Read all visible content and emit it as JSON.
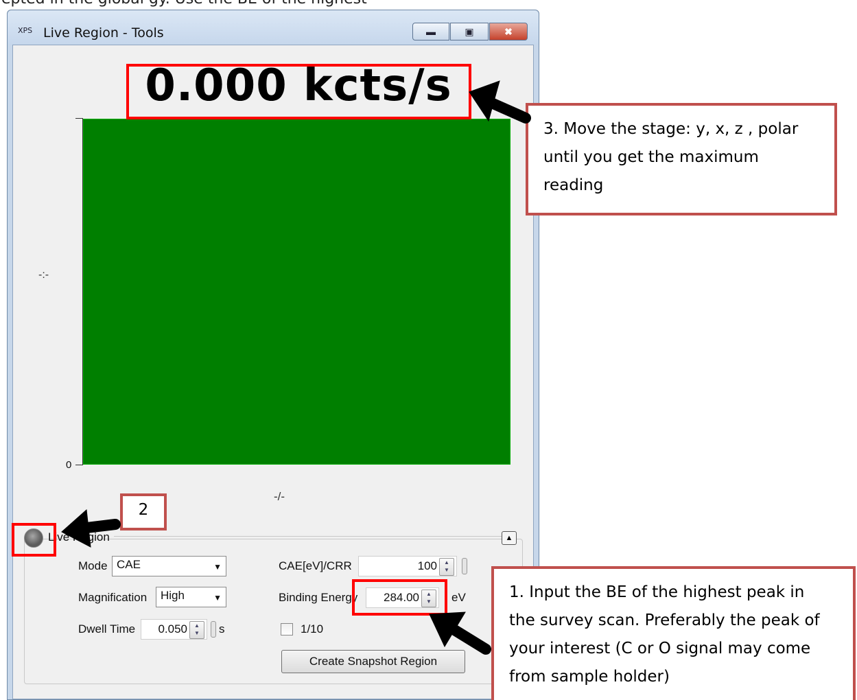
{
  "doc_text": "epted in the global gy. Use the BE of the highest",
  "window": {
    "app_icon": "XPS",
    "title": "Live Region - Tools",
    "buttons": {
      "minimize": "minimize-icon",
      "maximize": "maximize-icon",
      "close": "close-icon"
    }
  },
  "readout": {
    "value": "0.000 kcts/s"
  },
  "plot": {
    "y_zero": "0",
    "y_label": "-:-",
    "x_label": "-/-",
    "fill_color": "#007f00"
  },
  "panel": {
    "title": "Live Region",
    "mode_label": "Mode",
    "mode_value": "CAE",
    "magnification_label": "Magnification",
    "magnification_value": "High",
    "dwell_label": "Dwell Time",
    "dwell_value": "0.050",
    "dwell_unit": "s",
    "cae_label": "CAE[eV]/CRR",
    "cae_value": "100",
    "be_label": "Binding Energy",
    "be_value": "284.00",
    "be_unit": "eV",
    "tenth_label": "1/10",
    "snapshot_button": "Create Snapshot Region"
  },
  "annotations": {
    "step2": "2",
    "step3_lines": [
      "3. Move the stage: y, x, z , polar",
      "until you get the maximum",
      "reading"
    ],
    "step1_lines": [
      "1. Input the BE of the highest peak in",
      "the survey scan.  Preferably the peak of",
      "your interest (C or O signal may come",
      "from sample holder)"
    ],
    "highlight_color": "#ff0000",
    "callout_border": "#c0504d"
  }
}
